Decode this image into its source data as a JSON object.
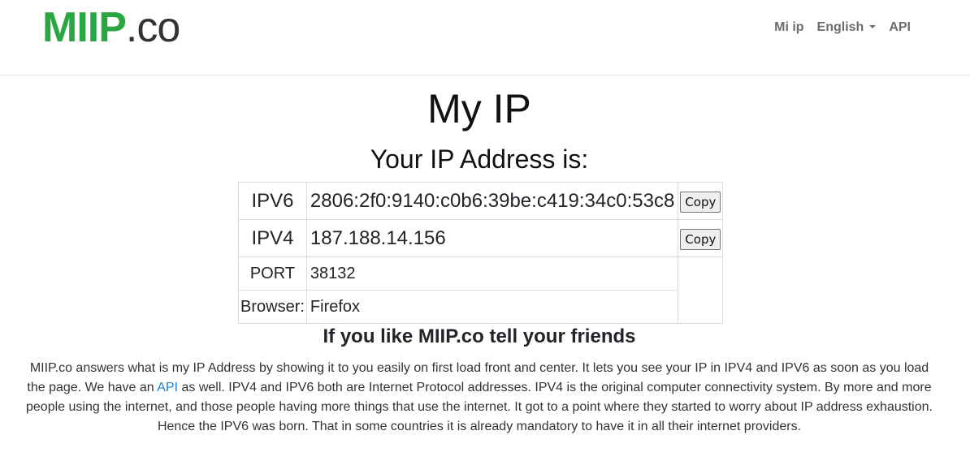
{
  "brand": {
    "primary": "MIIP",
    "suffix": ".co"
  },
  "nav": {
    "items": [
      "Mi ip",
      "English",
      "API"
    ]
  },
  "headings": {
    "title": "My IP",
    "subtitle": "Your IP Address is:",
    "share": "If you like MIIP.co tell your friends"
  },
  "ip_table": {
    "ipv6": {
      "label": "IPV6",
      "value": "2806:2f0:9140:c0b6:39be:c419:34c0:53c8",
      "button": "Copy"
    },
    "ipv4": {
      "label": "IPV4",
      "value": "187.188.14.156",
      "button": "Copy"
    },
    "port": {
      "label": "PORT",
      "value": "38132"
    },
    "browser": {
      "label": "Browser:",
      "value": "Firefox"
    }
  },
  "description": {
    "before_link": "MIIP.co answers what is my IP Address by showing it to you easily on first load front and center. It lets you see your IP in IPV4 and IPV6 as soon as you load the page. We have an ",
    "link": "API",
    "after_link": " as well. IPV4 and IPV6 both are Internet Protocol addresses. IPV4 is the original computer connectivity system. By more and more people using the internet, and those people having more things that use the internet. It got to a point where they started to worry about IP address exhaustion. Hence the IPV6 was born. That in some countries it is already mandatory to have it in all their internet providers."
  },
  "colors": {
    "brand_green": "#2aa642",
    "link_blue": "#1e7fd6",
    "nav_gray": "#6c6c6c"
  }
}
